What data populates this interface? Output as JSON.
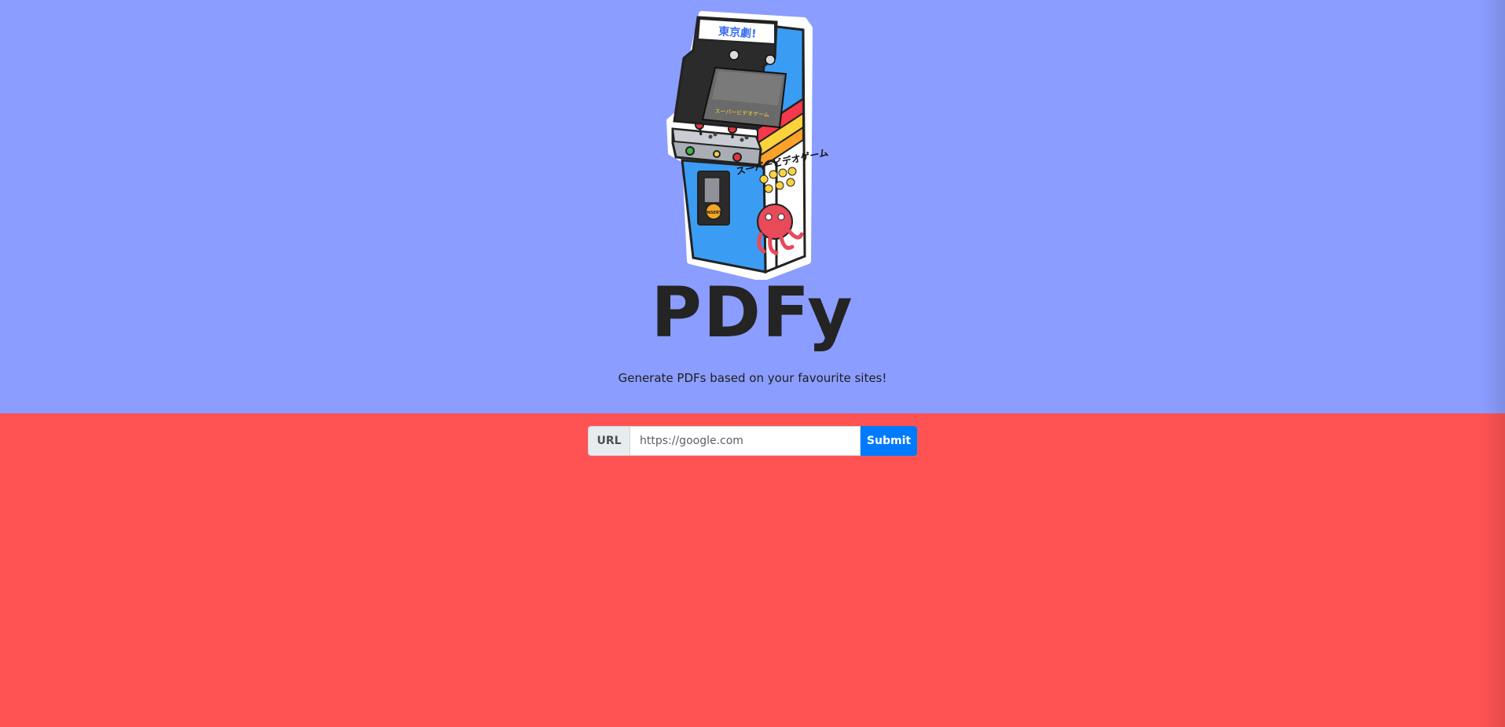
{
  "hero": {
    "title": "PDFy",
    "subtitle": "Generate PDFs based on your favourite sites!",
    "logo_icon": "arcade-cabinet-icon",
    "marquee_text": "東京劇!",
    "screen_text": "スーパービデオゲーム",
    "side_text": "スーパービデオゲーム",
    "coin_text": "INSERT"
  },
  "form": {
    "input_label": "URL",
    "input_placeholder": "https://google.com",
    "input_value": "",
    "submit_label": "Submit"
  },
  "colors": {
    "hero_background": "#8b9dfe",
    "bottom_background": "#ff5353",
    "title_text": "#242424",
    "button_primary": "#007bff",
    "cabinet_blue": "#3b9cf4",
    "stripe_red": "#f5384a",
    "stripe_yellow": "#fcd23d",
    "stripe_orange": "#fba229"
  }
}
